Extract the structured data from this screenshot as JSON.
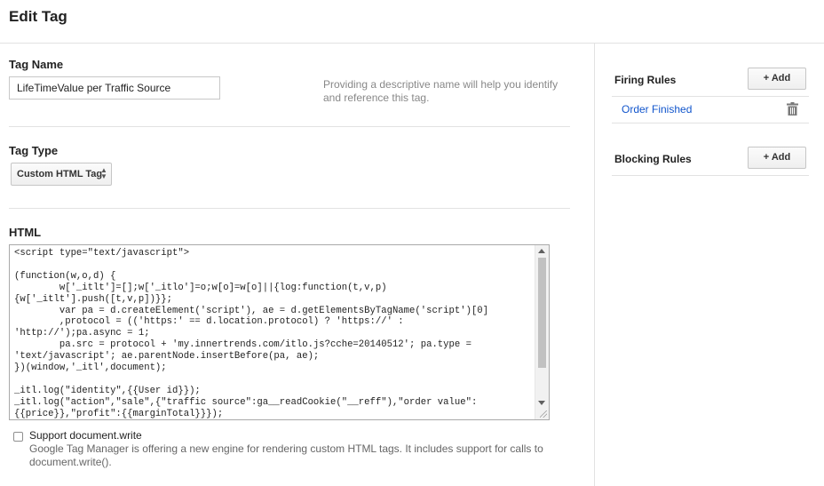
{
  "page": {
    "title": "Edit Tag"
  },
  "tag_name": {
    "label": "Tag Name",
    "value": "LifeTimeValue per Traffic Source",
    "hint": "Providing a descriptive name will help you identify and reference this tag."
  },
  "tag_type": {
    "label": "Tag Type",
    "selected": "Custom HTML Tag"
  },
  "html": {
    "label": "HTML",
    "code": "<script type=\"text/javascript\">\n\n(function(w,o,d) {\n        w['_itlt']=[];w['_itlo']=o;w[o]=w[o]||{log:function(t,v,p)\n{w['_itlt'].push([t,v,p])}};\n        var pa = d.createElement('script'), ae = d.getElementsByTagName('script')[0]\n        ,protocol = (('https:' == d.location.protocol) ? 'https://' :\n'http://');pa.async = 1;\n        pa.src = protocol + 'my.innertrends.com/itlo.js?cche=20140512'; pa.type =\n'text/javascript'; ae.parentNode.insertBefore(pa, ae);\n})(window,'_itl',document);\n\n_itl.log(\"identity\",{{User id}});\n_itl.log(\"action\",\"sale\",{\"traffic source\":ga__readCookie(\"__reff\"),\"order value\":\n{{price}},\"profit\":{{marginTotal}}});"
  },
  "support_write": {
    "label": "Support document.write",
    "description": "Google Tag Manager is offering a new engine for rendering custom HTML tags. It includes support for calls to document.write()."
  },
  "firing_rules": {
    "label": "Firing Rules",
    "add_label": "+ Add",
    "items": [
      {
        "name": "Order Finished"
      }
    ]
  },
  "blocking_rules": {
    "label": "Blocking Rules",
    "add_label": "+ Add"
  },
  "icons": {
    "trash": "trash-icon",
    "select_arrows": "up-down-arrows-icon"
  },
  "colors": {
    "link": "#1155cc",
    "hint": "#888888",
    "divider": "#e2e2e2"
  }
}
